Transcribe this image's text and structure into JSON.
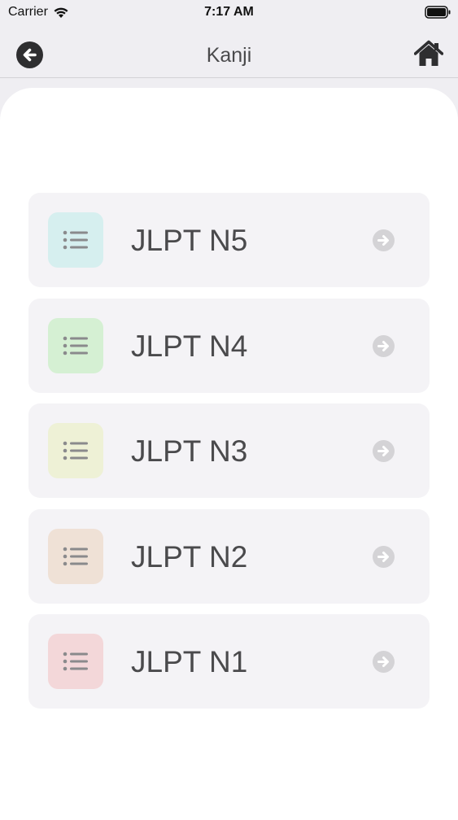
{
  "status_bar": {
    "carrier": "Carrier",
    "time": "7:17 AM"
  },
  "nav": {
    "title": "Kanji",
    "back_icon": "arrow-left-circle-icon",
    "home_icon": "home-icon"
  },
  "levels": [
    {
      "label": "JLPT N5",
      "icon_bg": "#d6efef",
      "icon": "list-icon"
    },
    {
      "label": "JLPT N4",
      "icon_bg": "#d5f0d3",
      "icon": "list-icon"
    },
    {
      "label": "JLPT N3",
      "icon_bg": "#eef1d6",
      "icon": "list-icon"
    },
    {
      "label": "JLPT N2",
      "icon_bg": "#efe1d6",
      "icon": "list-icon"
    },
    {
      "label": "JLPT N1",
      "icon_bg": "#f3d7d9",
      "icon": "list-icon"
    }
  ],
  "colors": {
    "background": "#efeef2",
    "card": "#f4f3f6",
    "arrow": "#d4d3d6",
    "list_icon": "#8a8a8c"
  }
}
